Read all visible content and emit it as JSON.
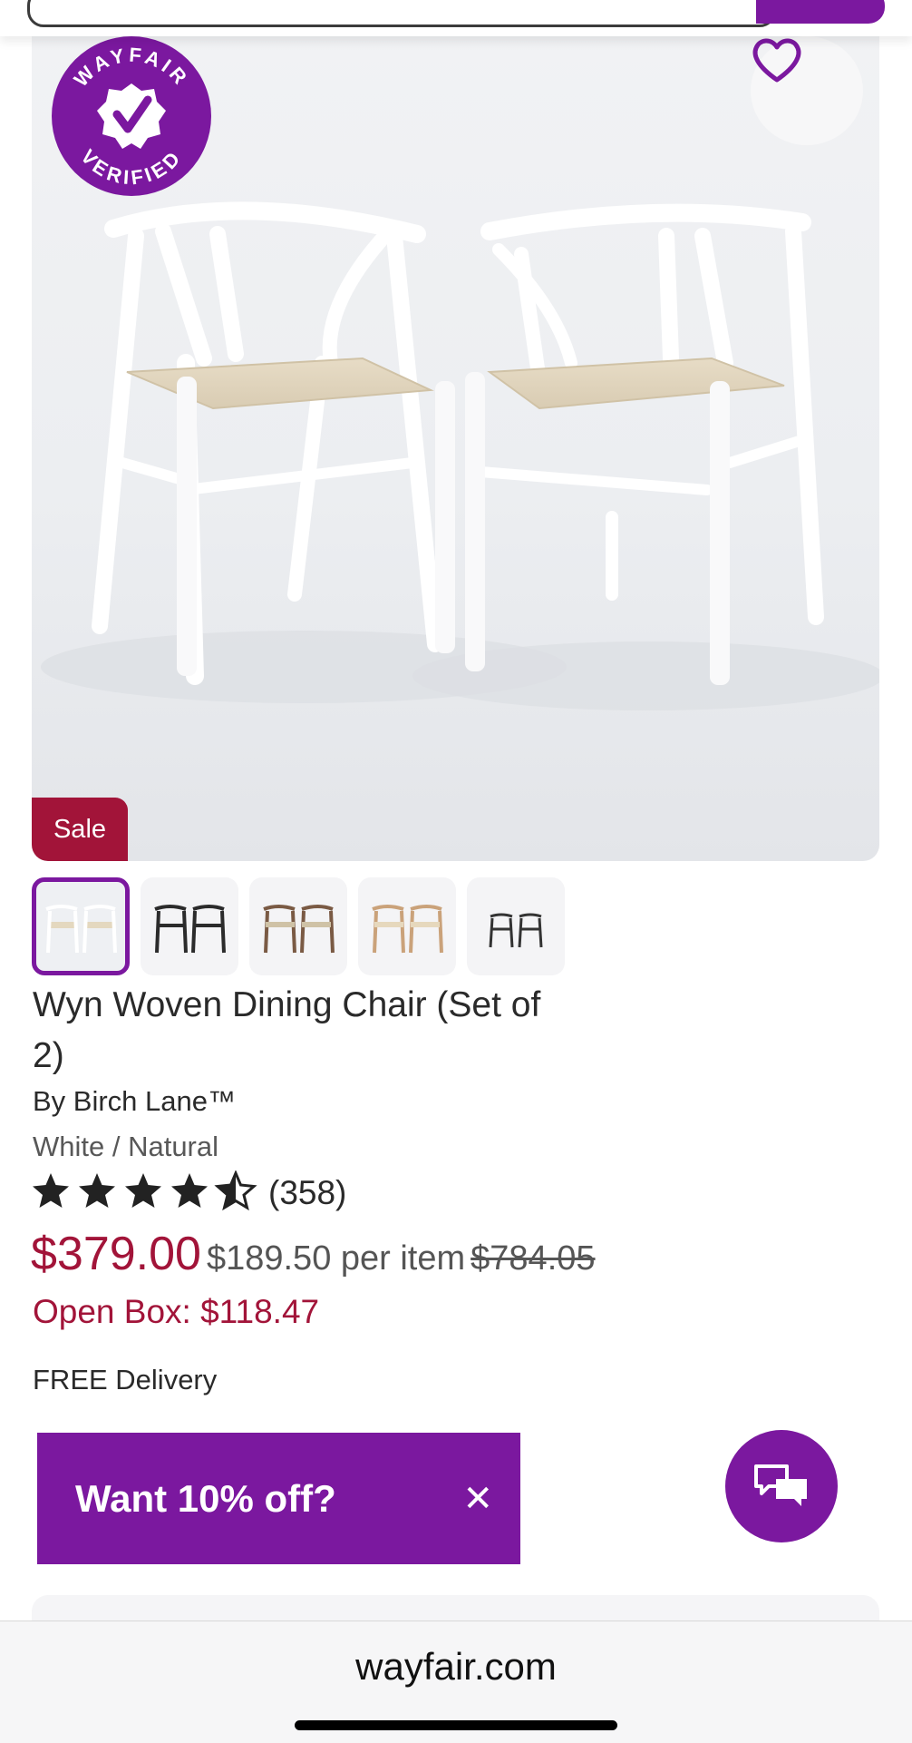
{
  "hero": {
    "badge_text_top": "WAYFAIR",
    "badge_text_bottom": "VERIFIED",
    "sale_label": "Sale"
  },
  "thumbnails": [
    {
      "name": "white-natural",
      "selected": true
    },
    {
      "name": "black"
    },
    {
      "name": "walnut"
    },
    {
      "name": "natural"
    },
    {
      "name": "black-small"
    }
  ],
  "product": {
    "title": "Wyn Woven Dining Chair (Set of 2)",
    "brand": "By Birch Lane™",
    "variant": "White / Natural",
    "rating_value": 4.5,
    "rating_count": "(358)",
    "price": "$379.00",
    "per_item": "$189.50 per item",
    "original_price": "$784.05",
    "open_box": "Open Box: $118.47",
    "delivery": "FREE Delivery"
  },
  "promo": {
    "text": "Want 10% off?",
    "close_glyph": "✕"
  },
  "browser": {
    "url": "wayfair.com"
  },
  "colors": {
    "brand_purple": "#7b189f",
    "sale_red": "#a21439"
  },
  "icons": [
    "heart-icon",
    "star-icon",
    "chat-icon",
    "close-icon",
    "verified-check-icon"
  ]
}
